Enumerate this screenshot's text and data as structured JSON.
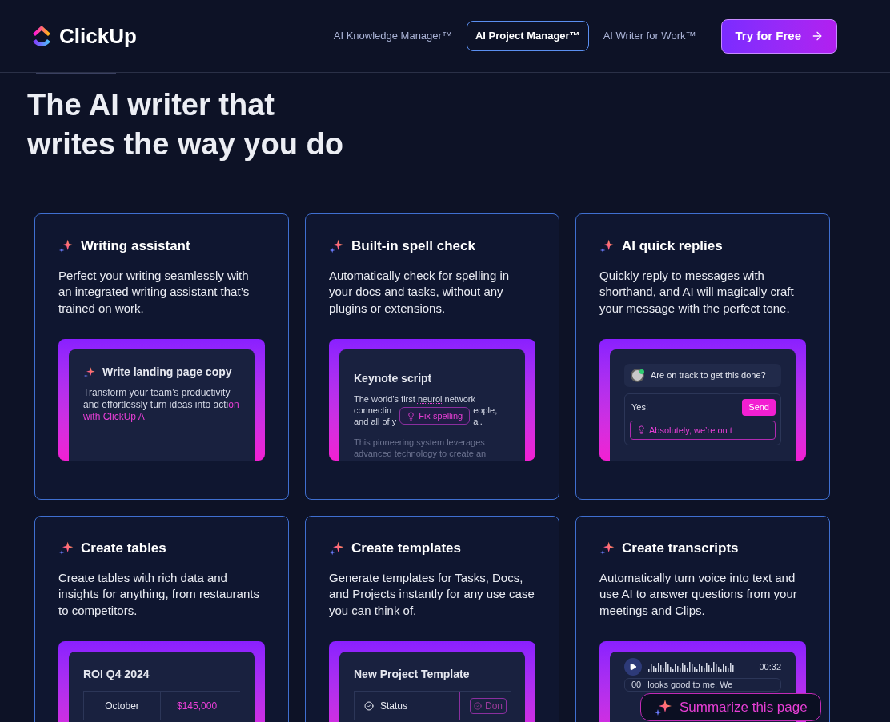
{
  "header": {
    "logo": "ClickUp",
    "nav": [
      {
        "label": "AI Knowledge Manager™",
        "selected": false
      },
      {
        "label": "AI Project Manager™",
        "selected": true
      },
      {
        "label": "AI Writer for Work™",
        "selected": false
      }
    ],
    "cta": "Try for Free"
  },
  "hero": {
    "title_lines": [
      "The AI writer that",
      "writes the way you do"
    ]
  },
  "features": [
    {
      "title": "Writing assistant",
      "description": "Perfect your writing seamlessly with an integrated writing assistant that’s trained on work.",
      "preview": {
        "kind": "writer",
        "title": "Write landing page copy",
        "text": "Transform your team’s productivity and effortlessly turn ideas into acti",
        "highlight": "on with ClickUp A"
      }
    },
    {
      "title": "Built-in spell check",
      "description": "Automatically check for spelling in your docs and tasks, without any plugins or extensions.",
      "preview": {
        "kind": "spell",
        "title": "Keynote script",
        "before": "The world’s first ",
        "error": "neurol",
        "after": " network",
        "left_lines": [
          "connectin",
          "and all of y"
        ],
        "popup": "Fix spelling",
        "right_lines": [
          "eople,",
          "al."
        ],
        "faded": "This pioneering system leverages advanced technology to create an"
      }
    },
    {
      "title": "AI quick replies",
      "description": "Quickly reply to messages with shorthand, and AI will magically craft your message with the perfect tone.",
      "preview": {
        "kind": "reply",
        "question": "Are on track to get this done?",
        "input": "Yes!",
        "send": "Send",
        "suggestion": "Absolutely, we’re on t"
      }
    },
    {
      "title": "Create tables",
      "description": "Create tables with rich data and insights for anything, from restaurants to competitors.",
      "preview": {
        "kind": "table",
        "title": "ROI Q4 2024",
        "rows": [
          {
            "label": "October",
            "value": "$145,000"
          }
        ]
      }
    },
    {
      "title": "Create templates",
      "description": "Generate templates for Tasks, Docs, and Projects instantly for any use case you can think of.",
      "preview": {
        "kind": "template",
        "title": "New Project Template",
        "rows": [
          {
            "label": "Status",
            "value": "Don"
          }
        ]
      }
    },
    {
      "title": "Create transcripts",
      "description": "Automatically turn voice into text and use AI to answer questions from your meetings and Clips.",
      "preview": {
        "kind": "transcript",
        "time": "00:32",
        "caption_time": "00",
        "caption": "looks good to me. We"
      }
    }
  ],
  "summarize_button": "Summarize this page"
}
